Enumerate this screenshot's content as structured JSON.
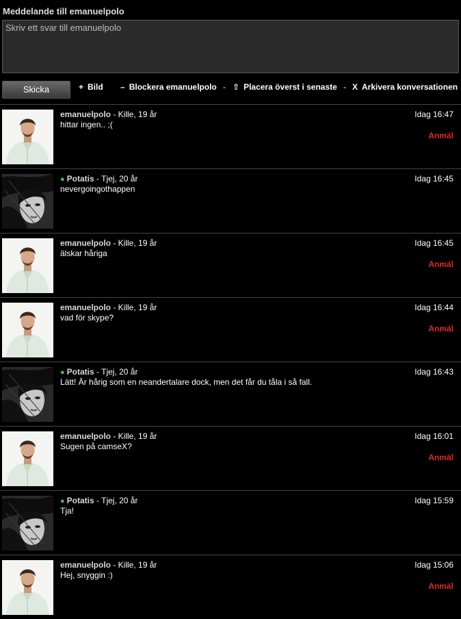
{
  "compose": {
    "title": "Meddelande till emanuelpolo",
    "placeholder": "Skriv ett svar till emanuelpolo",
    "send_label": "Skicka"
  },
  "actions": {
    "image": {
      "glyph": "+",
      "label": "Bild"
    },
    "block": {
      "glyph": "–",
      "label": "Blockera emanuelpolo"
    },
    "pin": {
      "glyph": "⇧",
      "label": "Placera överst i senaste"
    },
    "archive": {
      "glyph": "X",
      "label": "Arkivera konversationen"
    },
    "separator": "-"
  },
  "colors": {
    "online": "#2ecc40",
    "report": "#e0262b",
    "background": "#000000"
  },
  "messages": [
    {
      "name": "emanuelpolo",
      "info": " - Kille, 19 år",
      "online": false,
      "text": "hittar ingen.. ;(",
      "time": "Idag 16:47",
      "report": "Anmäl",
      "avatar": "man-avatar"
    },
    {
      "name": "Potatis",
      "info": " - Tjej, 20 år",
      "online": true,
      "text": "nevergoingothappen",
      "time": "Idag 16:45",
      "report": "",
      "avatar": "woman-avatar"
    },
    {
      "name": "emanuelpolo",
      "info": " - Kille, 19 år",
      "online": false,
      "text": "älskar håriga",
      "time": "Idag 16:45",
      "report": "Anmäl",
      "avatar": "man-avatar"
    },
    {
      "name": "emanuelpolo",
      "info": " - Kille, 19 år",
      "online": false,
      "text": "vad för skype?",
      "time": "Idag 16:44",
      "report": "Anmäl",
      "avatar": "man-avatar"
    },
    {
      "name": "Potatis",
      "info": " - Tjej, 20 år",
      "online": true,
      "text": "Lätt! Är hårig som en neandertalare dock, men det får du tåla i så fall.",
      "time": "Idag 16:43",
      "report": "",
      "avatar": "woman-avatar"
    },
    {
      "name": "emanuelpolo",
      "info": " - Kille, 19 år",
      "online": false,
      "text": "Sugen på camseX?",
      "time": "Idag 16:01",
      "report": "Anmäl",
      "avatar": "man-avatar"
    },
    {
      "name": "Potatis",
      "info": " - Tjej, 20 år",
      "online": true,
      "text": "Tja!",
      "time": "Idag 15:59",
      "report": "",
      "avatar": "woman-avatar"
    },
    {
      "name": "emanuelpolo",
      "info": " - Kille, 19 år",
      "online": false,
      "text": "Hej, snyggin :)",
      "time": "Idag 15:06",
      "report": "Anmäl",
      "avatar": "man-avatar"
    }
  ]
}
